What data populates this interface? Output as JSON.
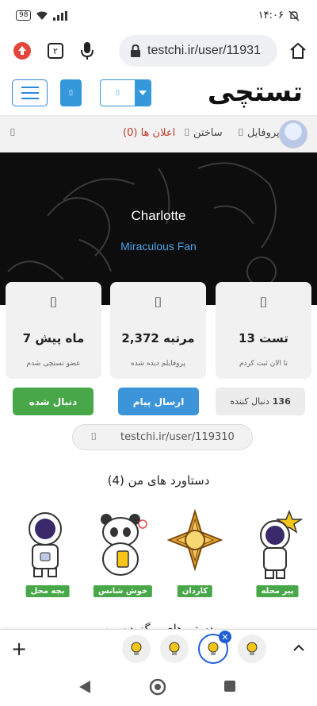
{
  "status_bar": {
    "battery": "98",
    "time": "۱۴:۰۶"
  },
  "browser": {
    "tab_count": "۲",
    "url": "testchi.ir/user/11931"
  },
  "header": {
    "logo": "تستچی",
    "lang_value": "⌷",
    "chip_glyph": "⌷"
  },
  "nav": {
    "profile_label": "پروفایل",
    "build_label": "ساختن",
    "notifications_label": "اعلان ها",
    "notifications_count": "(0)",
    "glyph": "⌷"
  },
  "hero": {
    "name": "Charlotte",
    "tagline": "Miraculous Fan"
  },
  "stats": [
    {
      "glyph": "⌷",
      "value": "13 تست",
      "caption": "تا الان ثبت کردم"
    },
    {
      "glyph": "⌷",
      "value": "2,372 مرتبه",
      "caption": "پروفایلم دیده شده"
    },
    {
      "glyph": "⌷",
      "value": "7 ماه پیش",
      "caption": "عضو تستچی شدم"
    }
  ],
  "actions": {
    "followed": "دنبال شده",
    "send_message": "ارسال پیام",
    "followers_count": "136",
    "followers_label": "دنبال کننده"
  },
  "profile_url": {
    "glyph": "⌷",
    "text": "testchi.ir/user/119310"
  },
  "achievements": {
    "title": "دستاورد های من (4)",
    "items": [
      {
        "label": "پیر محله"
      },
      {
        "label": "کاردان"
      },
      {
        "label": "خوش شانس"
      },
      {
        "label": "بچه محل"
      }
    ]
  },
  "cutoff_text": "دستورهای برگزیده من",
  "colors": {
    "accent_blue": "#3b95d8",
    "green": "#48a748",
    "notif_red": "#c0392b"
  }
}
